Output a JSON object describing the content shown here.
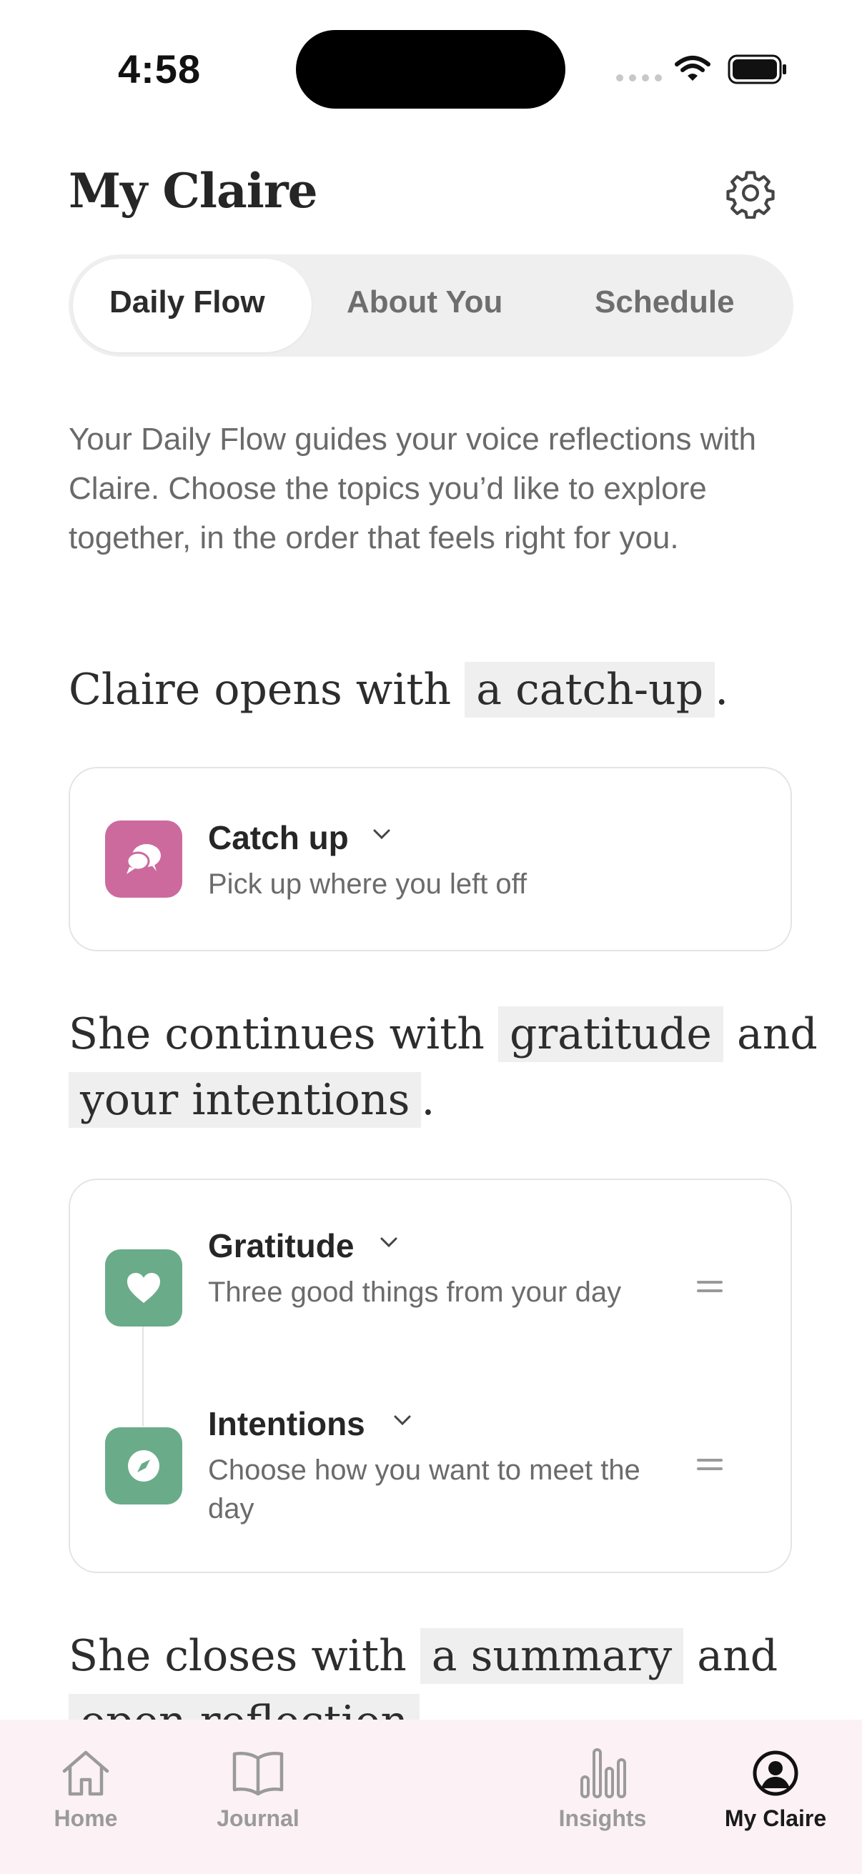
{
  "status": {
    "time": "4:58"
  },
  "header": {
    "title": "My Claire"
  },
  "tabs": [
    "Daily Flow",
    "About You",
    "Schedule"
  ],
  "intro": "Your Daily Flow guides your voice reflections with Claire. Choose the topics you’d like to explore together, in the order that feels right for you.",
  "section1": {
    "prefix": "Claire opens with",
    "chip": "a catch-up",
    "suffix": "."
  },
  "catchup": {
    "title": "Catch up",
    "subtitle": "Pick up where you left off"
  },
  "section2": {
    "prefix": "She continues with",
    "chip1": "gratitude",
    "middle": "and",
    "chip2": "your intentions",
    "suffix": "."
  },
  "gratitude": {
    "title": "Gratitude",
    "subtitle": "Three good things from your day"
  },
  "intentions": {
    "title": "Intentions",
    "subtitle": "Choose how you want to meet the day"
  },
  "section3": {
    "prefix": "She closes with",
    "chip1": "a summary",
    "middle": "and",
    "chip2": "open reflection"
  },
  "tabbar": {
    "home": "Home",
    "journal": "Journal",
    "insights": "Insights",
    "myclaire": "My Claire"
  },
  "colors": {
    "catchup": "#cc6a9e",
    "green": "#6aab8a",
    "active_tab": "#1a1a1a",
    "inactive_tab": "#9a9a9a"
  }
}
